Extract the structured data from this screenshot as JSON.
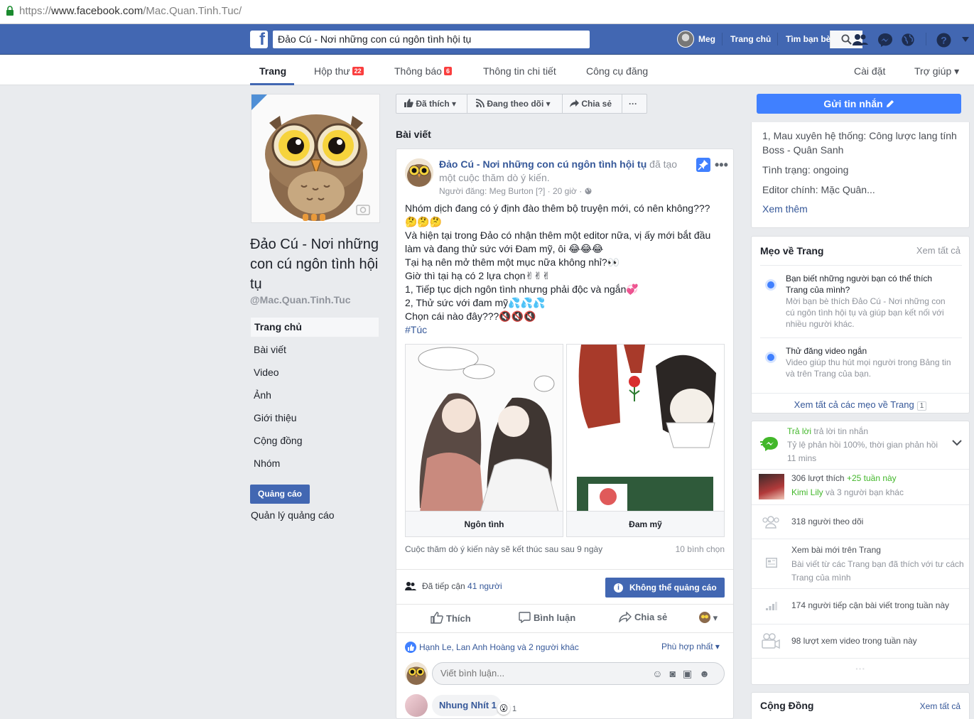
{
  "browser": {
    "url_scheme": "https://",
    "url_host": "www.facebook.com",
    "url_path": "/Mac.Quan.Tinh.Tuc/"
  },
  "topbar": {
    "logo": "f",
    "search_value": "Đảo Cú - Nơi những con cú ngôn tình hội tụ",
    "user_name": "Meg",
    "home": "Trang chủ",
    "find_friends": "Tìm bạn bè",
    "colors": {
      "blue": "#4267b2"
    }
  },
  "pagenav": {
    "tabs": [
      {
        "label": "Trang"
      },
      {
        "label": "Hộp thư",
        "badge": "22"
      },
      {
        "label": "Thông báo",
        "badge": "6"
      },
      {
        "label": "Thông tin chi tiết"
      },
      {
        "label": "Công cụ đăng"
      }
    ],
    "settings": "Cài đặt",
    "help": "Trợ giúp ▾"
  },
  "left": {
    "page_name": "Đảo Cú - Nơi những con cú ngôn tình hội tụ",
    "handle": "@Mac.Quan.Tinh.Tuc",
    "nav": [
      "Trang chủ",
      "Bài viết",
      "Video",
      "Ảnh",
      "Giới thiệu",
      "Cộng đồng",
      "Nhóm"
    ],
    "ad_button": "Quảng cáo",
    "manage_ads": "Quản lý quảng cáo"
  },
  "actions": {
    "liked": "Đã thích",
    "following": "Đang theo dõi",
    "share": "Chia sẻ",
    "more": "···"
  },
  "posts_label": "Bài viết",
  "post": {
    "author": "Đảo Cú - Nơi những con cú ngôn tình hội tụ",
    "action": " đã tạo một cuộc thăm dò ý kiến.",
    "meta": "Người đăng: Meg Burton [?] · 20 giờ · ",
    "lines": [
      "Nhóm dịch đang có ý định đào thêm bộ truyện mới, có nên không???",
      "🤔🤔🤔",
      "Và hiện tại trong Đảo có nhận thêm một editor nữa, vị ấy mới bắt đầu làm và đang thử sức với Đam mỹ, ôi 😂😂😂",
      "Tại hạ nên mở thêm một mục nữa không nhỉ?👀",
      "Giờ thì tại hạ có 2 lựa chọn✌✌✌",
      "1, Tiếp tục dịch ngôn tình nhưng phải độc và ngắn💞",
      "2, Thử sức với đam mỹ💦💦💦",
      "Chọn cái nào đây???🔇🔇🔇"
    ],
    "hashtag": "#Túc",
    "poll_options": [
      "Ngôn tình",
      "Đam mỹ"
    ],
    "poll_end": "Cuộc thăm dò ý kiến này sẽ kết thúc sau sau 9 ngày",
    "poll_votes": "10 bình chọn",
    "reach_prefix": "Đã tiếp cận ",
    "reach_link": "41 người",
    "no_ad": "Không thể quảng cáo",
    "like": "Thích",
    "comment": "Bình luận",
    "share": "Chia sẻ",
    "likers": "Hạnh Le, Lan Anh Hoàng và 2 người khác",
    "sort": "Phù hợp nhất ▾",
    "comment_placeholder": "Viết bình luận...",
    "comment_author": "Nhung Nhít 1",
    "comment_react_count": "1"
  },
  "right": {
    "send_message": "Gửi tin nhắn",
    "info": [
      "1, Mau xuyên hệ thống: Công lược lang tính Boss - Quân Sanh",
      "Tình trạng: ongoing",
      "Editor chính: Mặc Quân..."
    ],
    "see_more": "Xem thêm",
    "tips_title": "Mẹo về Trang",
    "tips_see_all": "Xem tất cả",
    "tips": [
      {
        "title": "Bạn biết những người bạn có thể thích Trang của mình?",
        "desc": "Mời bạn bè thích Đảo Cú - Nơi những con cú ngôn tình hội tụ và giúp bạn kết nối với nhiều người khác."
      },
      {
        "title": "Thử đăng video ngắn",
        "desc": "Video giúp thu hút mọi người trong Bảng tin và trên Trang của bạn."
      }
    ],
    "tips_all_link": "Xem tất cả các mẹo về Trang",
    "tips_all_count": "1",
    "reply_title": "Trả lời",
    "reply_title_rest": " trả lời tin nhắn",
    "reply_desc": "Tỷ lệ phản hồi 100%, thời gian phản hồi 11 mins",
    "likes_count": "306 lượt thích ",
    "likes_week": "+25 tuần này",
    "likes_friends_name": "Kimi Lily",
    "likes_friends_rest": " và 3 người bạn khác",
    "followers": "318 người theo dõi",
    "new_posts_title": "Xem bài mới trên Trang",
    "new_posts_desc": "Bài viết từ các Trang bạn đã thích với tư cách Trang của mình",
    "reach_week": "174 người tiếp cận bài viết trong tuần này",
    "video_views": "98 lượt xem video trong tuần này",
    "more_dots": "···",
    "community_title": "Cộng Đồng",
    "community_see_all": "Xem tất cả"
  }
}
